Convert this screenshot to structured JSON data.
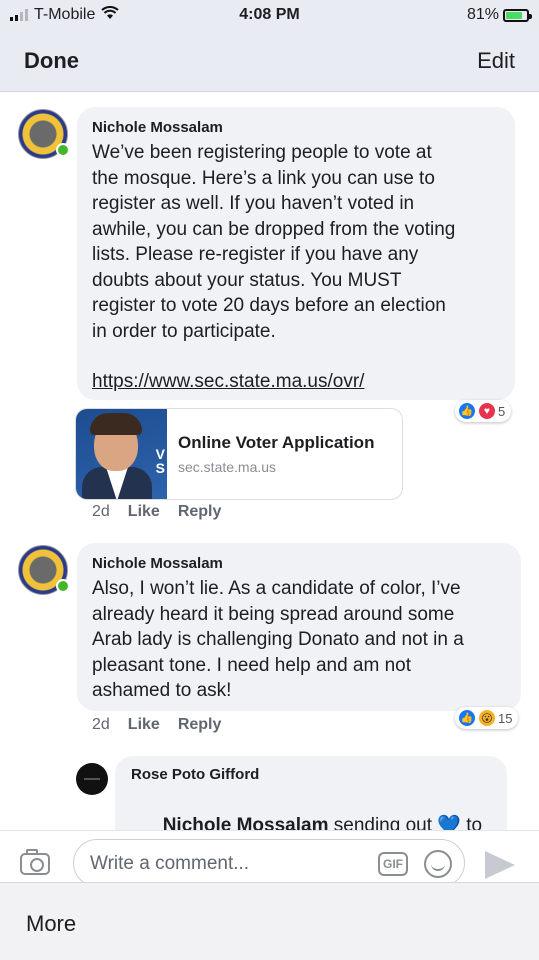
{
  "status_bar": {
    "carrier": "T-Mobile",
    "time": "4:08 PM",
    "battery": "81%",
    "battery_level": 0.81
  },
  "nav": {
    "left": "Done",
    "right": "Edit"
  },
  "comments": [
    {
      "author": "Nichole Mossalam",
      "text": "We’ve been registering people to vote at\nthe mosque. Here’s a link you can use to\nregister as well. If you haven’t voted in\nawhile, you can be dropped from the voting\nlists. Please re-register if you have any\ndoubts about your status. You MUST\nregister to vote 20 days before an election\nin order to participate.",
      "link": "https://www.sec.state.ma.us/ovr/",
      "preview": {
        "thumb_text": "V\nS",
        "title": "Online Voter Application",
        "domain": "sec.state.ma.us"
      },
      "time": "2d",
      "like": "Like",
      "reply": "Reply",
      "reaction_count": "5",
      "reaction_icons": [
        "like-icon",
        "love-icon"
      ]
    },
    {
      "author": "Nichole Mossalam",
      "text": "Also, I won’t lie. As a candidate of color, I’ve\nalready heard it being spread around some\nArab lady is challenging Donato and not in a\npleasant tone. I need help and am not\nashamed to ask!",
      "time": "2d",
      "like": "Like",
      "reply": "Reply",
      "reaction_count": "15",
      "reaction_icons": [
        "like-icon",
        "wow-icon"
      ]
    },
    {
      "author": "Rose Poto Gifford",
      "mention": "Nichole Mossalam",
      "text_after": " sending out 💙 to"
    }
  ],
  "composer": {
    "placeholder": "Write a comment...",
    "gif_label": "GIF"
  },
  "bottom": {
    "more": "More"
  }
}
